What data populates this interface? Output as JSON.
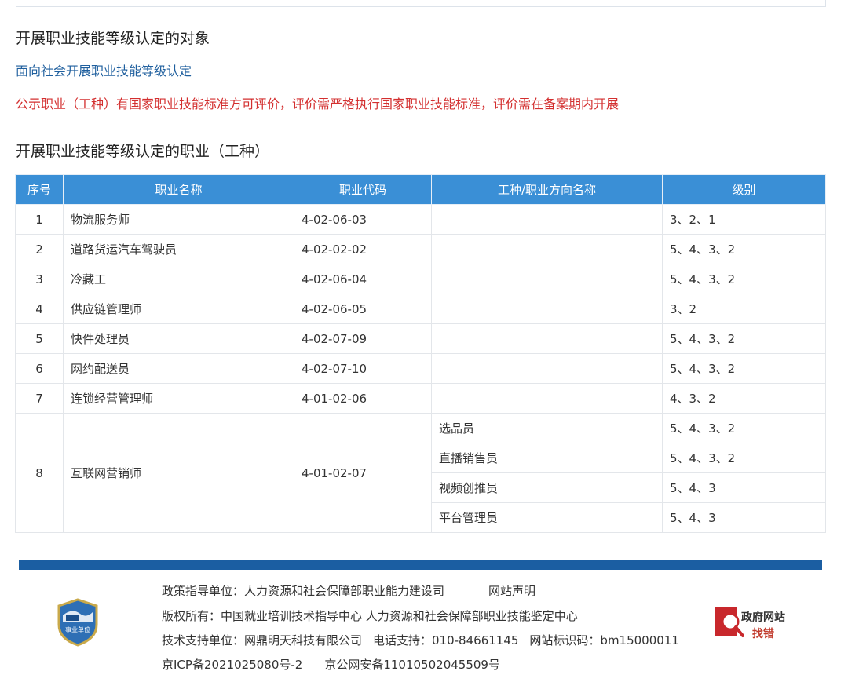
{
  "sections": {
    "object_heading": "开展职业技能等级认定的对象",
    "object_link": "面向社会开展职业技能等级认定",
    "notice": "公示职业（工种）有国家职业技能标准方可评价，评价需严格执行国家职业技能标准，评价需在备案期内开展",
    "jobs_heading": "开展职业技能等级认定的职业（工种）"
  },
  "table": {
    "headers": [
      "序号",
      "职业名称",
      "职业代码",
      "工种/职业方向名称",
      "级别"
    ],
    "rows": [
      {
        "idx": "1",
        "name": "物流服务师",
        "code": "4-02-06-03",
        "direction": "",
        "level": "3、2、1"
      },
      {
        "idx": "2",
        "name": "道路货运汽车驾驶员",
        "code": "4-02-02-02",
        "direction": "",
        "level": "5、4、3、2"
      },
      {
        "idx": "3",
        "name": "冷藏工",
        "code": "4-02-06-04",
        "direction": "",
        "level": "5、4、3、2"
      },
      {
        "idx": "4",
        "name": "供应链管理师",
        "code": "4-02-06-05",
        "direction": "",
        "level": "3、2"
      },
      {
        "idx": "5",
        "name": "快件处理员",
        "code": "4-02-07-09",
        "direction": "",
        "level": "5、4、3、2"
      },
      {
        "idx": "6",
        "name": "网约配送员",
        "code": "4-02-07-10",
        "direction": "",
        "level": "5、4、3、2"
      },
      {
        "idx": "7",
        "name": "连锁经营管理师",
        "code": "4-01-02-06",
        "direction": "",
        "level": "4、3、2"
      }
    ],
    "group": {
      "idx": "8",
      "name": "互联网营销师",
      "code": "4-01-02-07",
      "subs": [
        {
          "direction": "选品员",
          "level": "5、4、3、2"
        },
        {
          "direction": "直播销售员",
          "level": "5、4、3、2"
        },
        {
          "direction": "视频创推员",
          "level": "5、4、3"
        },
        {
          "direction": "平台管理员",
          "level": "5、4、3"
        }
      ]
    }
  },
  "footer": {
    "policy": "政策指导单位：人力资源和社会保障部职业能力建设司",
    "statement": "网站声明",
    "copyright": "版权所有：中国就业培训技术指导中心  人力资源和社会保障部职业技能鉴定中心",
    "tech_support": "技术支持单位：网鼎明天科技有限公司",
    "phone": "电话支持：010-84661145",
    "site_id": "网站标识码：bm15000011",
    "icp": "京ICP备2021025080号-2",
    "police": "京公网安备11010502045509号",
    "emblem_text": "事业单位",
    "gov_title": "政府网站",
    "gov_sub": "找错"
  },
  "colors": {
    "header_blue": "#3a8fd6",
    "footer_bar": "#1b5ea2",
    "link_blue": "#1f5f9e",
    "notice_red": "#d32f2f"
  },
  "icons": [
    "institution-emblem-icon",
    "gov-site-error-report-icon"
  ]
}
